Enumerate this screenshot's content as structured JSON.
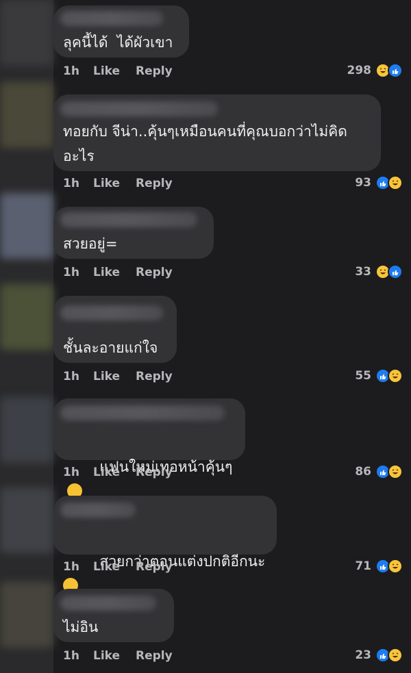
{
  "comments": [
    {
      "text": "ลุคนี้ได้  ได้ผัวเขา",
      "time": "1h",
      "like": "Like",
      "reply": "Reply",
      "count": "298",
      "reactions": [
        "haha",
        "like"
      ]
    },
    {
      "text": "ทอยกับ จีน่า..คุ้นๆเหมือนคนที่คุณบอกว่าไม่คิด\nอะไร",
      "time": "1h",
      "like": "Like",
      "reply": "Reply",
      "count": "93",
      "reactions": [
        "like",
        "haha"
      ]
    },
    {
      "text": "สวยอยู่=",
      "time": "1h",
      "like": "Like",
      "reply": "Reply",
      "count": "33",
      "reactions": [
        "haha",
        "like"
      ]
    },
    {
      "text": "ชั้นละอายแก่ใจ",
      "time": "1h",
      "like": "Like",
      "reply": "Reply",
      "count": "55",
      "reactions": [
        "like",
        "haha"
      ]
    },
    {
      "text": "แฟนใหม่เทอหน้าคุ้นๆ",
      "time": "1h",
      "like": "Like",
      "reply": "Reply",
      "count": "86",
      "reactions": [
        "like",
        "haha"
      ]
    },
    {
      "text": "สวยกว่าตอนแต่งปกติอีกนะ",
      "time": "1h",
      "like": "Like",
      "reply": "Reply",
      "count": "71",
      "reactions": [
        "like",
        "haha"
      ]
    },
    {
      "text": "ไม่อิน",
      "time": "1h",
      "like": "Like",
      "reply": "Reply",
      "count": "23",
      "reactions": [
        "like",
        "haha"
      ]
    }
  ],
  "colors": {
    "background": "#1c1c1e",
    "bubble": "#333336",
    "text": "#f0f0f0",
    "meta": "#b8b8bc",
    "like_icon": "#1d7cf2",
    "haha_icon": "#f7c53c"
  }
}
